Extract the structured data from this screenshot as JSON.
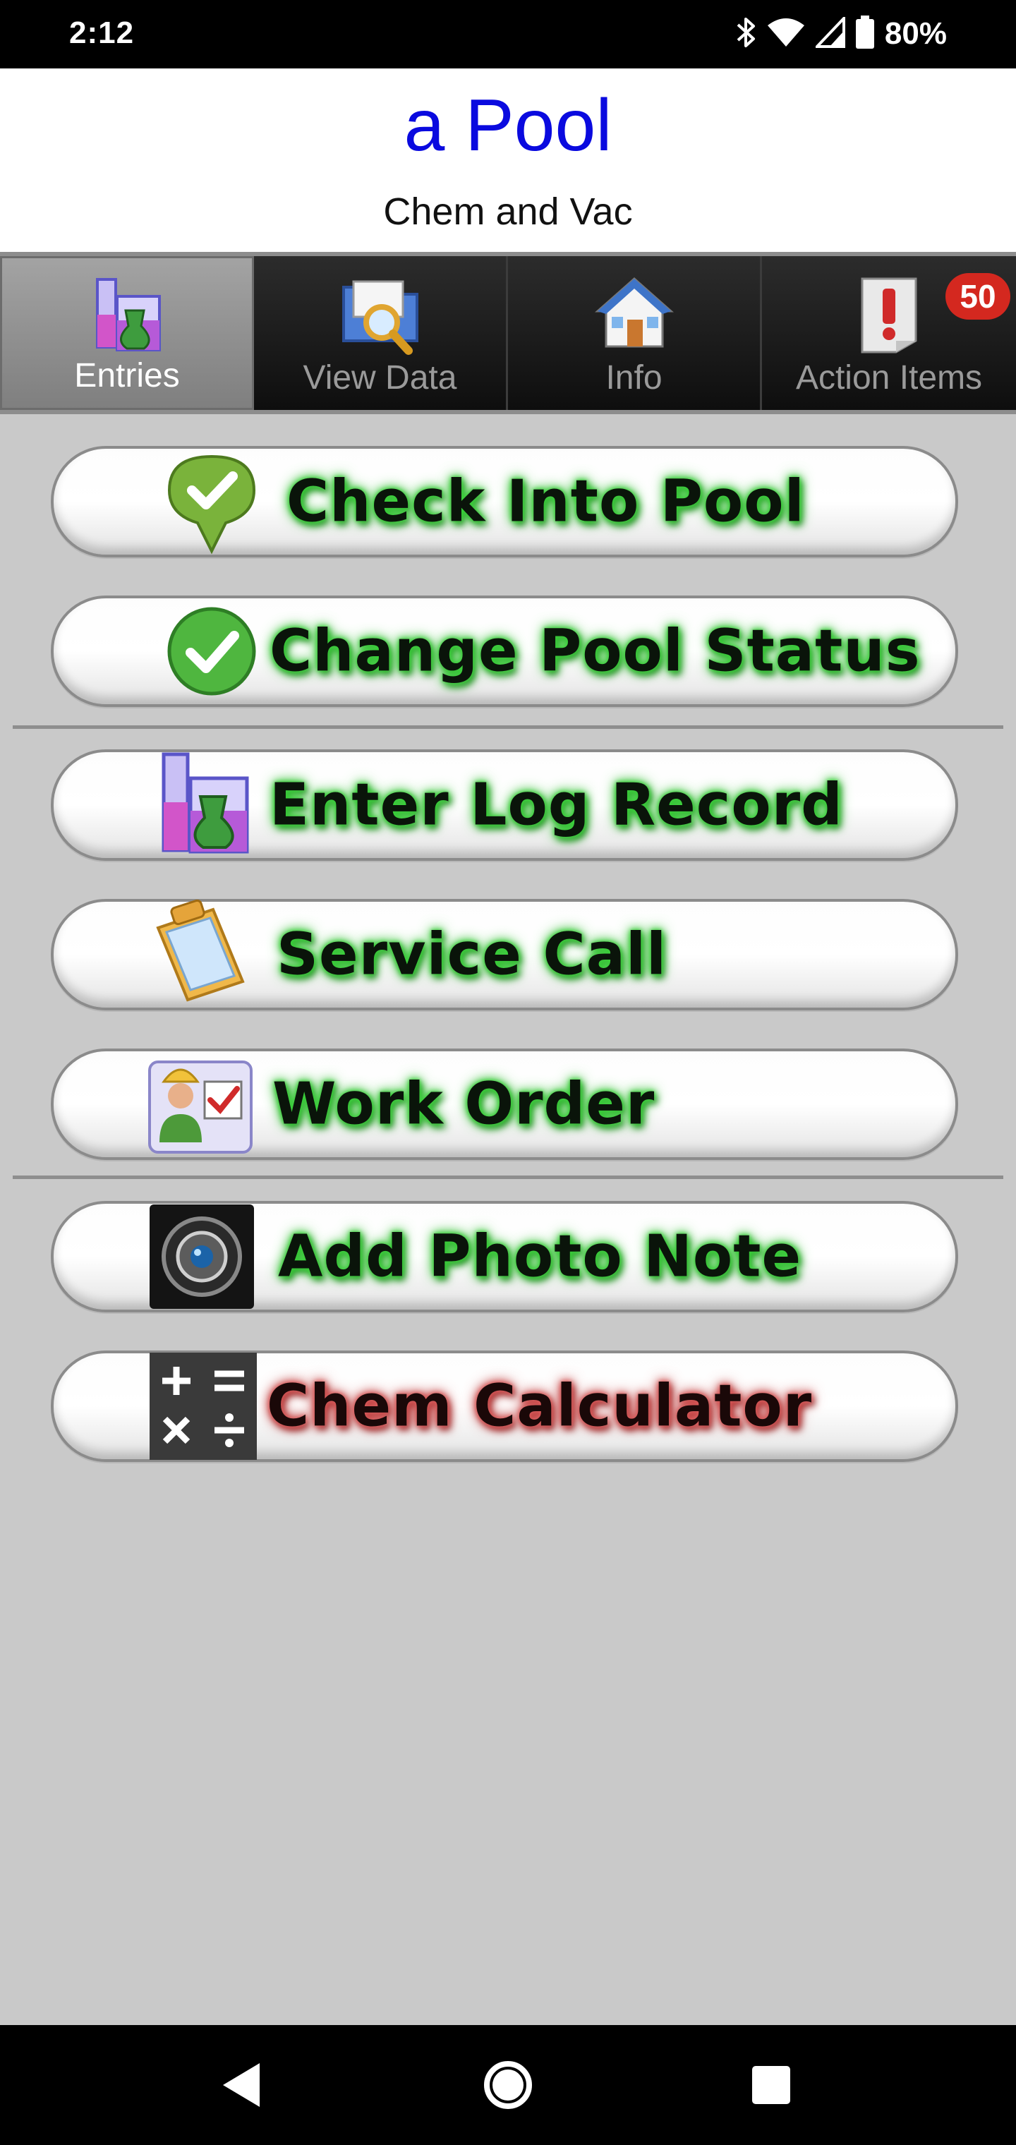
{
  "status_bar": {
    "time": "2:12",
    "battery_percent": "80%",
    "icons": [
      "bluetooth-icon",
      "wifi-icon",
      "cell-signal-icon",
      "battery-icon"
    ]
  },
  "header": {
    "title": "a Pool",
    "subtitle": "Chem and Vac",
    "title_color": "#0a0adf"
  },
  "tabs": [
    {
      "label": "Entries",
      "icon": "beaker-icon",
      "active": true
    },
    {
      "label": "View Data",
      "icon": "folder-search-icon",
      "active": false
    },
    {
      "label": "Info",
      "icon": "house-icon",
      "active": false
    },
    {
      "label": "Action Items",
      "icon": "alert-document-icon",
      "active": false,
      "badge": "50"
    }
  ],
  "buttons": [
    {
      "label": "Check Into Pool",
      "icon": "map-pin-check-icon"
    },
    {
      "label": "Change Pool Status",
      "icon": "green-check-circle-icon"
    },
    {
      "label": "Enter Log Record",
      "icon": "beaker-icon"
    },
    {
      "label": "Service Call",
      "icon": "clipboard-icon"
    },
    {
      "label": "Work Order",
      "icon": "work-order-icon"
    },
    {
      "label": "Add Photo Note",
      "icon": "camera-icon"
    },
    {
      "label": "Chem Calculator",
      "icon": "calculator-icon"
    }
  ],
  "colors": {
    "background": "#c9c9c9",
    "label_glow_green": "#3bd23b",
    "label_glow_red": "#d04848",
    "badge": "#d4281f"
  },
  "nav_bar": {
    "buttons": [
      "back-icon",
      "home-icon",
      "recents-icon"
    ]
  }
}
